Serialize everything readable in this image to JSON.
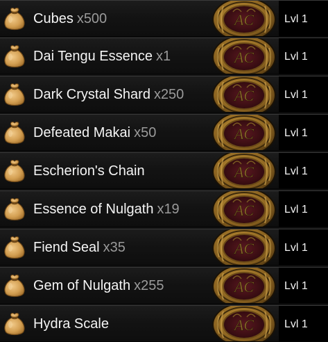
{
  "inventory": {
    "items": [
      {
        "name": "Cubes",
        "qty": "x500",
        "level": "Lvl 1"
      },
      {
        "name": "Dai Tengu Essence",
        "qty": "x1",
        "level": "Lvl 1"
      },
      {
        "name": "Dark Crystal Shard",
        "qty": "x250",
        "level": "Lvl 1"
      },
      {
        "name": "Defeated Makai",
        "qty": "x50",
        "level": "Lvl 1"
      },
      {
        "name": "Escherion's Chain",
        "qty": "",
        "level": "Lvl 1"
      },
      {
        "name": "Essence of Nulgath",
        "qty": "x19",
        "level": "Lvl 1"
      },
      {
        "name": "Fiend Seal",
        "qty": "x35",
        "level": "Lvl 1"
      },
      {
        "name": "Gem of Nulgath",
        "qty": "x255",
        "level": "Lvl 1"
      },
      {
        "name": "Hydra Scale",
        "qty": "",
        "level": "Lvl 1"
      }
    ],
    "item_icon": "item-bag-icon",
    "badge_icon": "ac-coin-icon",
    "badge_text": "AC"
  },
  "colors": {
    "item_name": "#f4f4f4",
    "item_qty": "#9a9a9a",
    "bag_gold": "#d8a95c",
    "badge_gold": "#9a7226",
    "badge_center": "#3a0d12"
  }
}
